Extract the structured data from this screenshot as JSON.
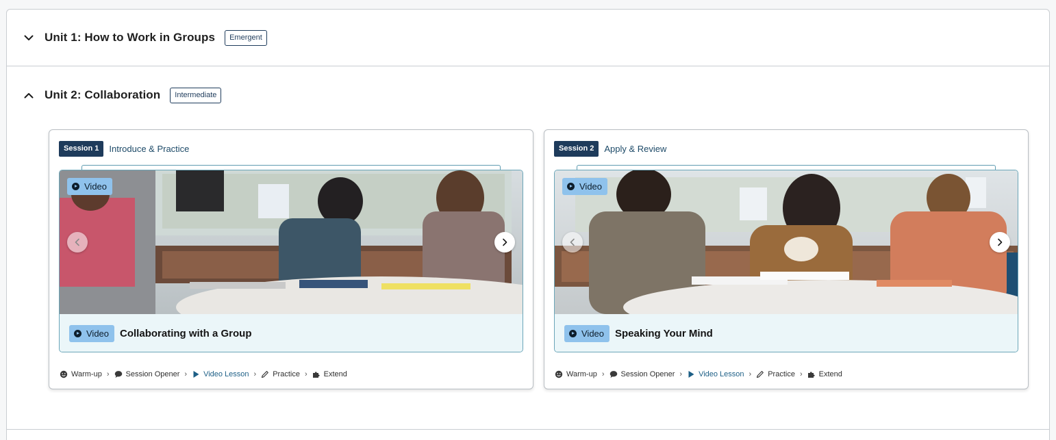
{
  "units": [
    {
      "title": "Unit 1: How to Work in Groups",
      "level": "Emergent",
      "expanded": false,
      "chevron_icon": "chevron-down-icon"
    },
    {
      "title": "Unit 2: Collaboration",
      "level": "Intermediate",
      "expanded": true,
      "chevron_icon": "chevron-up-icon"
    }
  ],
  "sessions": [
    {
      "badge": "Session 1",
      "name": "Introduce & Practice",
      "media_chip": "Video",
      "caption_chip": "Video",
      "caption_title": "Collaborating with a Group",
      "steps": [
        "Warm-up",
        "Session Opener",
        "Video Lesson",
        "Practice",
        "Extend"
      ],
      "active_step": "Video Lesson"
    },
    {
      "badge": "Session 2",
      "name": "Apply & Review",
      "media_chip": "Video",
      "caption_chip": "Video",
      "caption_title": "Speaking Your Mind",
      "steps": [
        "Warm-up",
        "Session Opener",
        "Video Lesson",
        "Practice",
        "Extend"
      ],
      "active_step": "Video Lesson"
    }
  ],
  "colors": {
    "navy": "#1e3b5b",
    "link": "#1d5f86",
    "video_chip": "#8fc2ec",
    "caption_bg": "#ebf6f9"
  },
  "icons": {
    "step_icons": [
      "smile-icon",
      "speech-bubble-icon",
      "play-icon",
      "pencil-icon",
      "puzzle-icon"
    ],
    "step_separator": "chevron-right-icon"
  }
}
